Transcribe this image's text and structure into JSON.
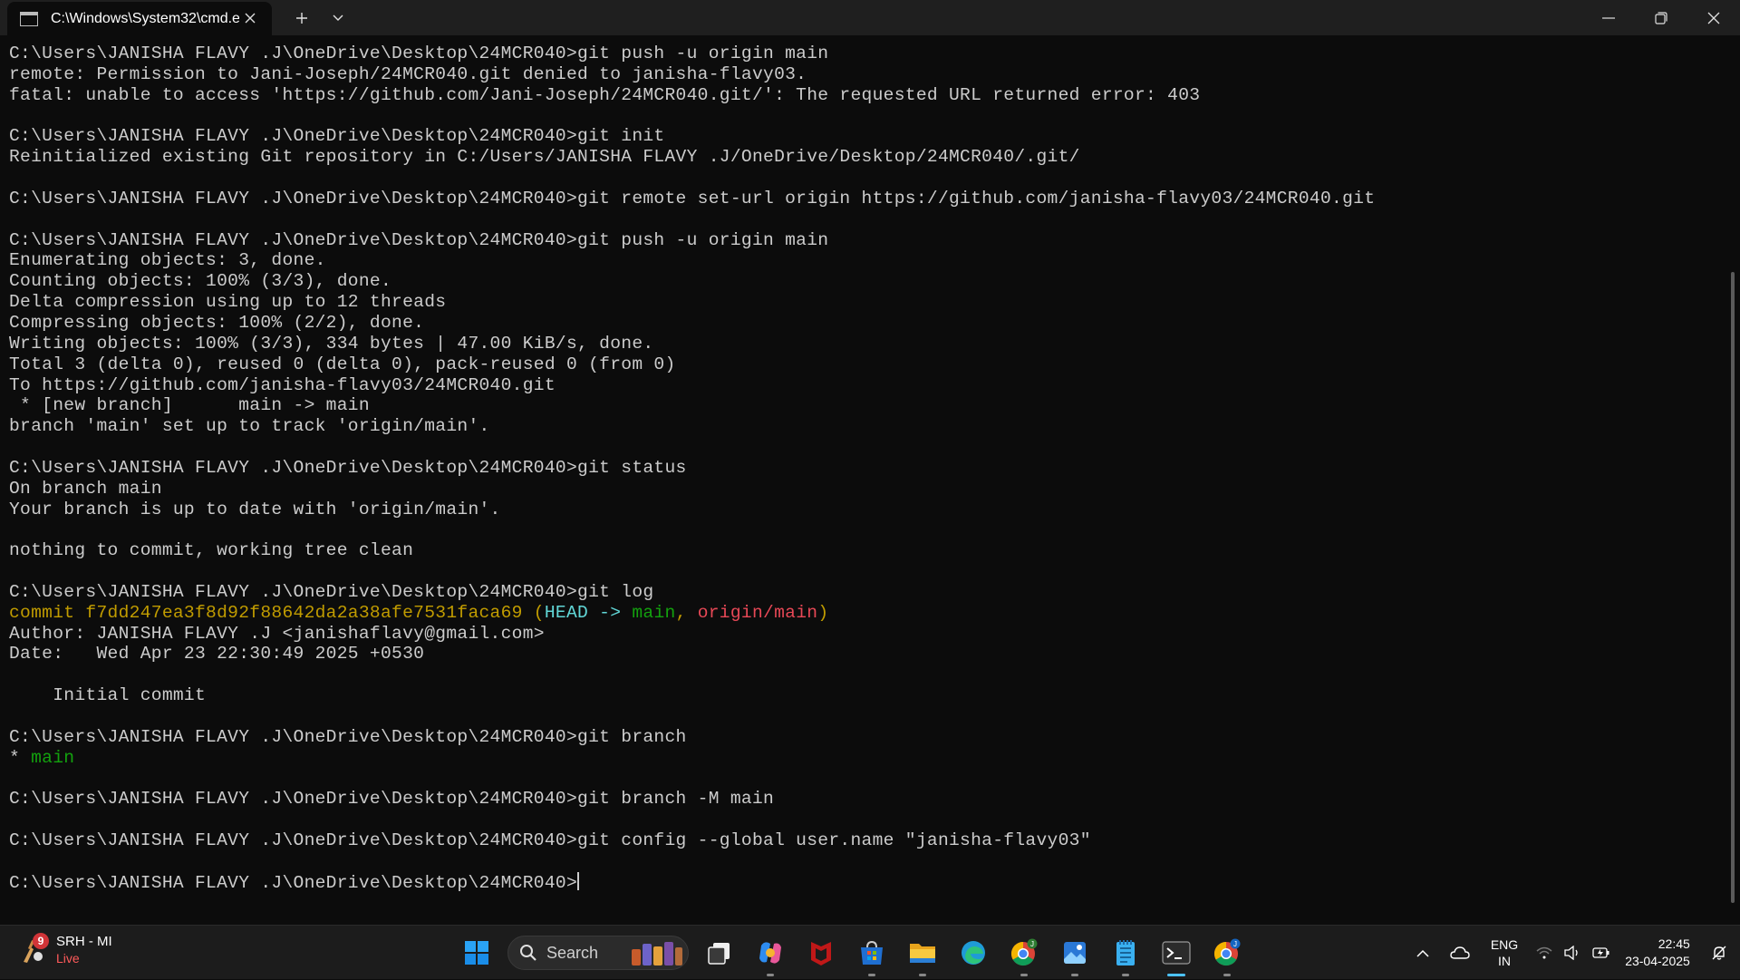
{
  "window": {
    "tab_title": "C:\\Windows\\System32\\cmd.e",
    "icon": "terminal-icon"
  },
  "terminal": {
    "lines": [
      [
        {
          "t": "C:\\Users\\JANISHA FLAVY .J\\OneDrive\\Desktop\\24MCR040>git push -u origin main"
        }
      ],
      [
        {
          "t": "remote: Permission to Jani-Joseph/24MCR040.git denied to janisha-flavy03."
        }
      ],
      [
        {
          "t": "fatal: unable to access 'https://github.com/Jani-Joseph/24MCR040.git/': The requested URL returned error: 403"
        }
      ],
      [
        {
          "t": ""
        }
      ],
      [
        {
          "t": "C:\\Users\\JANISHA FLAVY .J\\OneDrive\\Desktop\\24MCR040>git init"
        }
      ],
      [
        {
          "t": "Reinitialized existing Git repository in C:/Users/JANISHA FLAVY .J/OneDrive/Desktop/24MCR040/.git/"
        }
      ],
      [
        {
          "t": ""
        }
      ],
      [
        {
          "t": "C:\\Users\\JANISHA FLAVY .J\\OneDrive\\Desktop\\24MCR040>git remote set-url origin https://github.com/janisha-flavy03/24MCR040.git"
        }
      ],
      [
        {
          "t": ""
        }
      ],
      [
        {
          "t": "C:\\Users\\JANISHA FLAVY .J\\OneDrive\\Desktop\\24MCR040>git push -u origin main"
        }
      ],
      [
        {
          "t": "Enumerating objects: 3, done."
        }
      ],
      [
        {
          "t": "Counting objects: 100% (3/3), done."
        }
      ],
      [
        {
          "t": "Delta compression using up to 12 threads"
        }
      ],
      [
        {
          "t": "Compressing objects: 100% (2/2), done."
        }
      ],
      [
        {
          "t": "Writing objects: 100% (3/3), 334 bytes | 47.00 KiB/s, done."
        }
      ],
      [
        {
          "t": "Total 3 (delta 0), reused 0 (delta 0), pack-reused 0 (from 0)"
        }
      ],
      [
        {
          "t": "To https://github.com/janisha-flavy03/24MCR040.git"
        }
      ],
      [
        {
          "t": " * [new branch]      main -> main"
        }
      ],
      [
        {
          "t": "branch 'main' set up to track 'origin/main'."
        }
      ],
      [
        {
          "t": ""
        }
      ],
      [
        {
          "t": "C:\\Users\\JANISHA FLAVY .J\\OneDrive\\Desktop\\24MCR040>git status"
        }
      ],
      [
        {
          "t": "On branch main"
        }
      ],
      [
        {
          "t": "Your branch is up to date with 'origin/main'."
        }
      ],
      [
        {
          "t": ""
        }
      ],
      [
        {
          "t": "nothing to commit, working tree clean"
        }
      ],
      [
        {
          "t": ""
        }
      ],
      [
        {
          "t": "C:\\Users\\JANISHA FLAVY .J\\OneDrive\\Desktop\\24MCR040>git log"
        }
      ],
      [
        {
          "t": "commit f7dd247ea3f8d92f88642da2a38afe7531faca69 (",
          "c": "yellow"
        },
        {
          "t": "HEAD -> ",
          "c": "cyanb"
        },
        {
          "t": "main",
          "c": "green"
        },
        {
          "t": ", ",
          "c": "yellow"
        },
        {
          "t": "origin/main",
          "c": "red"
        },
        {
          "t": ")",
          "c": "yellow"
        }
      ],
      [
        {
          "t": "Author: JANISHA FLAVY .J <janishaflavy@gmail.com>"
        }
      ],
      [
        {
          "t": "Date:   Wed Apr 23 22:30:49 2025 +0530"
        }
      ],
      [
        {
          "t": ""
        }
      ],
      [
        {
          "t": "    Initial commit"
        }
      ],
      [
        {
          "t": ""
        }
      ],
      [
        {
          "t": "C:\\Users\\JANISHA FLAVY .J\\OneDrive\\Desktop\\24MCR040>git branch"
        }
      ],
      [
        {
          "t": "* "
        },
        {
          "t": "main",
          "c": "green"
        }
      ],
      [
        {
          "t": ""
        }
      ],
      [
        {
          "t": "C:\\Users\\JANISHA FLAVY .J\\OneDrive\\Desktop\\24MCR040>git branch -M main"
        }
      ],
      [
        {
          "t": ""
        }
      ],
      [
        {
          "t": "C:\\Users\\JANISHA FLAVY .J\\OneDrive\\Desktop\\24MCR040>git config --global user.name \"janisha-flavy03\""
        }
      ],
      [
        {
          "t": ""
        }
      ],
      [
        {
          "t": "C:\\Users\\JANISHA FLAVY .J\\OneDrive\\Desktop\\24MCR040>",
          "cursor": true
        }
      ]
    ],
    "colors": {
      "yellow": "#c19c00",
      "cyanb": "#61d6d6",
      "green": "#13a10e",
      "red": "#e74856",
      "text": "#cccccc",
      "background": "#0c0c0c"
    }
  },
  "taskbar": {
    "widget": {
      "badge": "9",
      "title": "SRH - MI",
      "subtitle": "Live",
      "icon": "cricket-widget-icon"
    },
    "search_label": "Search",
    "apps": [
      {
        "name": "task-view-icon",
        "running": false
      },
      {
        "name": "copilot-icon",
        "running": true
      },
      {
        "name": "mcafee-icon",
        "running": false
      },
      {
        "name": "microsoft-store-icon",
        "running": true
      },
      {
        "name": "file-explorer-icon",
        "running": true
      },
      {
        "name": "edge-icon",
        "running": false
      },
      {
        "name": "chrome-profile-icon",
        "running": true
      },
      {
        "name": "photos-icon",
        "running": true
      },
      {
        "name": "notepad-icon",
        "running": true
      },
      {
        "name": "terminal-icon",
        "running": true,
        "active": true
      },
      {
        "name": "chrome-icon",
        "running": true
      }
    ],
    "tray": {
      "lang_line1": "ENG",
      "lang_line2": "IN",
      "time": "22:45",
      "date": "23-04-2025"
    }
  }
}
